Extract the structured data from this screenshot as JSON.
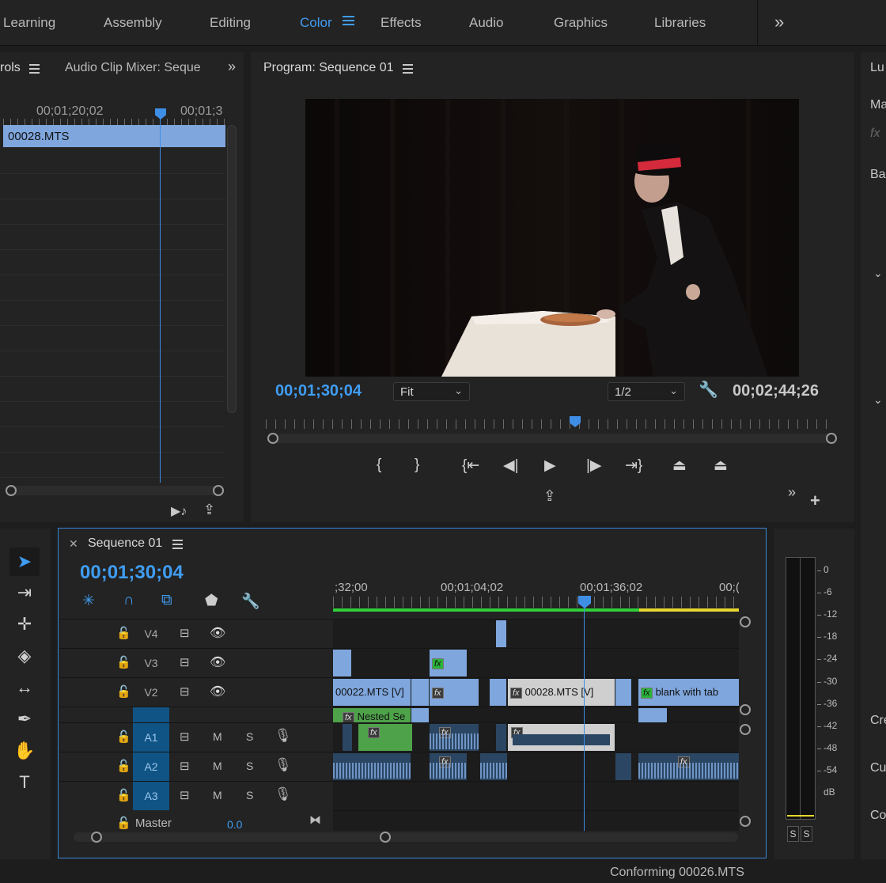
{
  "workspaces": [
    {
      "label": "Learning",
      "active": false
    },
    {
      "label": "Assembly",
      "active": false
    },
    {
      "label": "Editing",
      "active": false
    },
    {
      "label": "Color",
      "active": true
    },
    {
      "label": "Effects",
      "active": false
    },
    {
      "label": "Audio",
      "active": false
    },
    {
      "label": "Graphics",
      "active": false
    },
    {
      "label": "Libraries",
      "active": false
    }
  ],
  "left_panel": {
    "tab1": "rols",
    "tab2": "Audio Clip Mixer: Seque",
    "timecode_start": "00;01;20;02",
    "timecode_end": "00;01;3",
    "clip_name": "00028.MTS"
  },
  "program": {
    "title": "Program: Sequence 01",
    "current_time": "00;01;30;04",
    "zoom": "Fit",
    "resolution": "1/2",
    "duration": "00;02;44;26",
    "playhead_fraction": 0.55
  },
  "right_panel": {
    "items": [
      "Lu",
      "Ma",
      "fx",
      "Ba",
      "Cre",
      "Cu",
      "Co"
    ]
  },
  "timeline": {
    "title": "Sequence 01",
    "timecode": "00;01;30;04",
    "ruler": [
      ";32;00",
      "00;01;04;02",
      "00;01;36;02",
      "00;("
    ],
    "tracks_video": [
      {
        "name": "V4"
      },
      {
        "name": "V3"
      },
      {
        "name": "V2"
      }
    ],
    "tracks_audio": [
      {
        "name": "A1",
        "m": "M",
        "s": "S"
      },
      {
        "name": "A2",
        "m": "M",
        "s": "S"
      },
      {
        "name": "A3",
        "m": "M",
        "s": "S"
      }
    ],
    "clips": {
      "v2_1": "00022.MTS [V]",
      "v2_2": "00028.MTS [V]",
      "v2_3": "blank with tab",
      "v1_1": "Nested Se"
    },
    "fx_label": "fx",
    "master_label": "Master",
    "master_value": "0.0"
  },
  "meter": {
    "scale": [
      "0",
      "-6",
      "-12",
      "-18",
      "-24",
      "-30",
      "-36",
      "-42",
      "-48",
      "-54",
      "dB"
    ],
    "solo": [
      "S",
      "S"
    ]
  },
  "status": "Conforming 00026.MTS",
  "colors": {
    "accent": "#3f9df3",
    "video_clip": "#7fa6dd",
    "render_green": "#2fcf3a",
    "render_yellow": "#e6d630"
  }
}
